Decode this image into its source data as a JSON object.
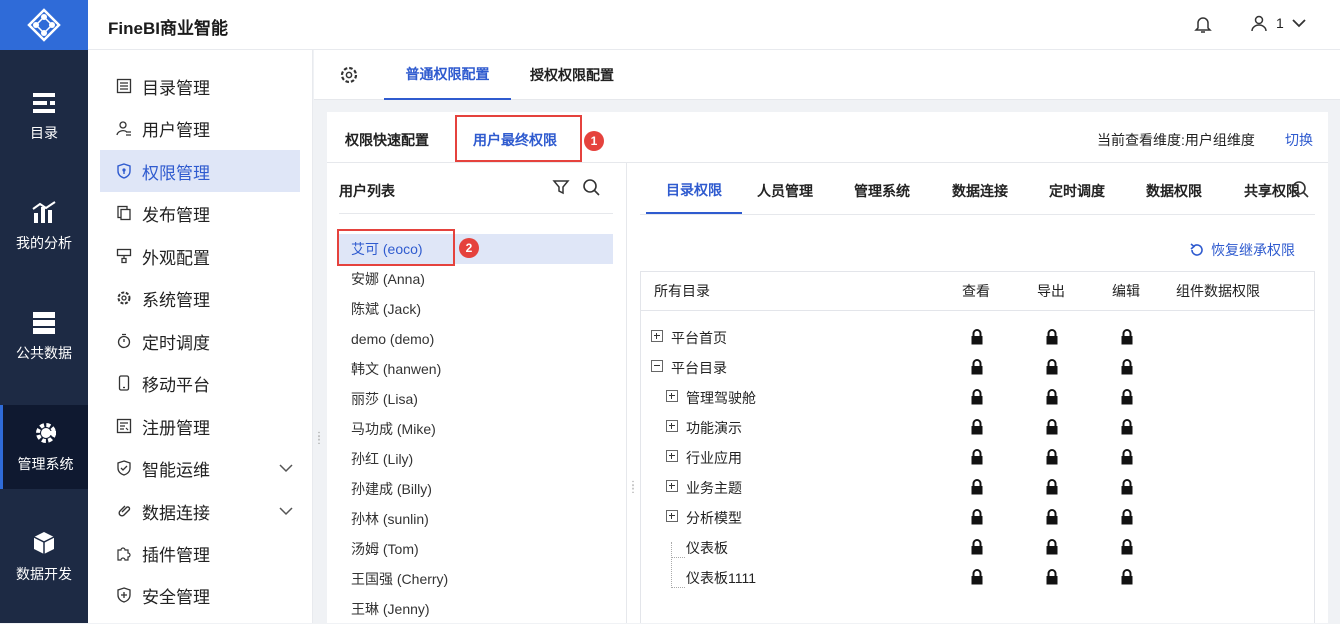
{
  "app": {
    "title": "FineBI商业智能"
  },
  "header": {
    "user_label": "1"
  },
  "rail": {
    "items": [
      {
        "label": "目录",
        "icon": "catalog-icon"
      },
      {
        "label": "我的分析",
        "icon": "analysis-icon"
      },
      {
        "label": "公共数据",
        "icon": "database-icon"
      },
      {
        "label": "管理系统",
        "icon": "gear-icon"
      },
      {
        "label": "数据开发",
        "icon": "cube-icon"
      }
    ]
  },
  "menu": {
    "items": [
      {
        "label": "目录管理",
        "icon": "list-icon"
      },
      {
        "label": "用户管理",
        "icon": "user-icon"
      },
      {
        "label": "权限管理",
        "icon": "shield-icon"
      },
      {
        "label": "发布管理",
        "icon": "copy-icon"
      },
      {
        "label": "外观配置",
        "icon": "paint-icon"
      },
      {
        "label": "系统管理",
        "icon": "gear-icon"
      },
      {
        "label": "定时调度",
        "icon": "timer-icon"
      },
      {
        "label": "移动平台",
        "icon": "mobile-icon"
      },
      {
        "label": "注册管理",
        "icon": "register-icon"
      },
      {
        "label": "智能运维",
        "icon": "ops-icon"
      },
      {
        "label": "数据连接",
        "icon": "link-icon"
      },
      {
        "label": "插件管理",
        "icon": "puzzle-icon"
      },
      {
        "label": "安全管理",
        "icon": "security-icon"
      }
    ]
  },
  "top_tabs": {
    "common": "普通权限配置",
    "grant": "授权权限配置"
  },
  "sub_tabs": {
    "quick": "权限快速配置",
    "final": "用户最终权限"
  },
  "dimension": {
    "label": "当前查看维度:用户组维度",
    "switch": "切换"
  },
  "user_list": {
    "title": "用户列表",
    "users": [
      "艾可 (eoco)",
      "安娜 (Anna)",
      "陈斌 (Jack)",
      "demo (demo)",
      "韩文 (hanwen)",
      "丽莎 (Lisa)",
      "马功成 (Mike)",
      "孙红 (Lily)",
      "孙建成 (Billy)",
      "孙林 (sunlin)",
      "汤姆 (Tom)",
      "王国强 (Cherry)",
      "王琳 (Jenny)"
    ]
  },
  "perm_tabs": [
    "目录权限",
    "人员管理",
    "管理系统",
    "数据连接",
    "定时调度",
    "数据权限",
    "共享权限"
  ],
  "restore_label": "恢复继承权限",
  "table": {
    "columns": [
      "所有目录",
      "查看",
      "导出",
      "编辑",
      "组件数据权限"
    ],
    "rows": [
      {
        "label": "平台首页",
        "level": 0,
        "node": "plus"
      },
      {
        "label": "平台目录",
        "level": 0,
        "node": "minus"
      },
      {
        "label": "管理驾驶舱",
        "level": 1,
        "node": "plus"
      },
      {
        "label": "功能演示",
        "level": 1,
        "node": "plus"
      },
      {
        "label": "行业应用",
        "level": 1,
        "node": "plus"
      },
      {
        "label": "业务主题",
        "level": 1,
        "node": "plus"
      },
      {
        "label": "分析模型",
        "level": 1,
        "node": "plus"
      },
      {
        "label": "仪表板",
        "level": 1,
        "node": "leaf"
      },
      {
        "label": "仪表板1111",
        "level": 1,
        "node": "leaf"
      }
    ]
  },
  "annotations": [
    "1",
    "2"
  ],
  "colors": {
    "accent": "#2f5bcf",
    "rail": "#1d2a44",
    "highlight": "#e5423d"
  }
}
